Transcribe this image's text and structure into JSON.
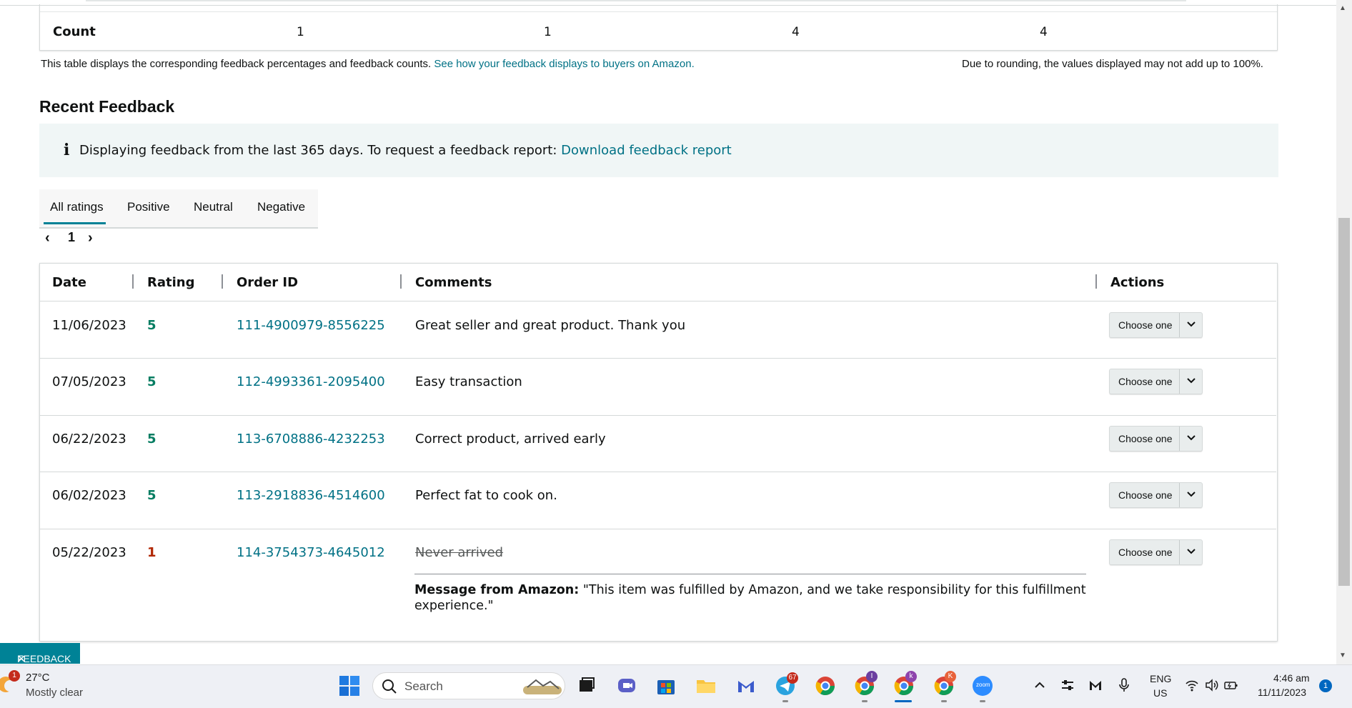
{
  "count_table": {
    "label": "Count",
    "values": [
      "1",
      "1",
      "4",
      "4"
    ]
  },
  "notes": {
    "left": "This table displays the corresponding feedback percentages and feedback counts.",
    "link": "See how your feedback displays to buyers on Amazon.",
    "right": "Due to rounding, the values displayed may not add up to 100%."
  },
  "recent": {
    "title": "Recent Feedback",
    "info_icon": "i",
    "info_text": "Displaying feedback from the last 365 days. To request a feedback report:",
    "info_link": "Download feedback report"
  },
  "tabs": [
    "All ratings",
    "Positive",
    "Neutral",
    "Negative"
  ],
  "pager": {
    "prev": "‹",
    "page": "1",
    "next": "›"
  },
  "table": {
    "headers": [
      "Date",
      "Rating",
      "Order ID",
      "Comments",
      "Actions"
    ],
    "rows": [
      {
        "date": "11/06/2023",
        "rating": "5",
        "order": "111-4900979-8556225",
        "comment": "Great seller and great product. Thank you",
        "action": "Choose one"
      },
      {
        "date": "07/05/2023",
        "rating": "5",
        "order": "112-4993361-2095400",
        "comment": "Easy transaction",
        "action": "Choose one"
      },
      {
        "date": "06/22/2023",
        "rating": "5",
        "order": "113-6708886-4232253",
        "comment": "Correct product, arrived early",
        "action": "Choose one"
      },
      {
        "date": "06/02/2023",
        "rating": "5",
        "order": "113-2918836-4514600",
        "comment": "Perfect fat to cook on.",
        "action": "Choose one"
      },
      {
        "date": "05/22/2023",
        "rating": "1",
        "order": "114-3754373-4645012",
        "comment": "Never arrived",
        "action": "Choose one"
      }
    ],
    "amazon_message_label": "Message from Amazon:",
    "amazon_message": "\"This item was fulfilled by Amazon, and we take responsibility for this fulfillment experience.\""
  },
  "feedback_tab": {
    "label": "FEEDBACK",
    "close": "✕"
  },
  "taskbar": {
    "weather_badge": "1",
    "temperature": "27°C",
    "weather": "Mostly clear",
    "search_placeholder": "Search",
    "telegram_badge": "67",
    "chrome_profile_1": "I",
    "chrome_profile_2": "k",
    "chrome_profile_3": "K",
    "zoom_label": "zoom",
    "lang_top": "ENG",
    "lang_bottom": "US",
    "time": "4:46 am",
    "date": "11/11/2023",
    "notifications": "1"
  },
  "colors": {
    "link": "#007185",
    "positive": "#067d62",
    "negative": "#b12704",
    "accent": "#008296"
  }
}
